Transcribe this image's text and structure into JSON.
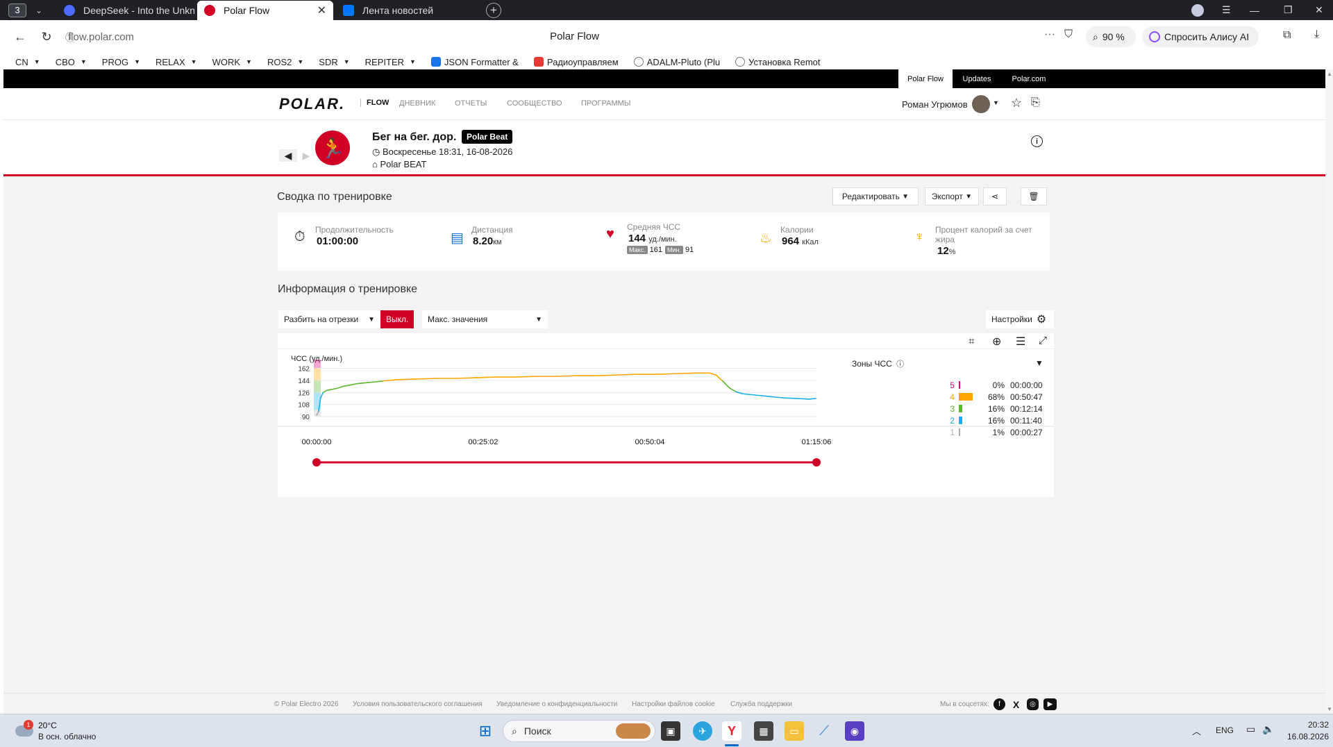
{
  "browser": {
    "tab_count": "3",
    "tabs": [
      {
        "title": "DeepSeek - Into the Unkno",
        "icon_color": "#4d6bfe"
      },
      {
        "title": "Polar Flow",
        "icon_color": "#d10027"
      },
      {
        "title": "Лента новостей",
        "icon_color": "#0077ff"
      }
    ],
    "url": "flow.polar.com",
    "page_title": "Polar Flow",
    "zoom": "90 %",
    "alice_label": "Спросить Алису AI",
    "bookmarks": [
      {
        "label": "CN",
        "folder": true
      },
      {
        "label": "CBO",
        "folder": true
      },
      {
        "label": "PROG",
        "folder": true
      },
      {
        "label": "RELAX",
        "folder": true
      },
      {
        "label": "WORK",
        "folder": true
      },
      {
        "label": "ROS2",
        "folder": true
      },
      {
        "label": "SDR",
        "folder": true
      },
      {
        "label": "REPITER",
        "folder": true
      },
      {
        "label": "JSON Formatter &",
        "folder": false
      },
      {
        "label": "Радиоуправляем",
        "folder": false
      },
      {
        "label": "ADALM-Pluto (Plu",
        "folder": false
      },
      {
        "label": "Установка Remot",
        "folder": false
      }
    ]
  },
  "site": {
    "top_links": [
      "Polar Flow",
      "Updates",
      "Polar.com"
    ],
    "logo": "POLAR.",
    "logo_sub": "FLOW",
    "nav": [
      "ДНЕВНИК",
      "ОТЧЕТЫ",
      "СООБЩЕСТВО",
      "ПРОГРАММЫ"
    ],
    "user_name": "Роман Угрюмов"
  },
  "activity": {
    "title": "Бег на бег. дор.",
    "badge": "Polar Beat",
    "date": "Воскресенье 18:31, 16-08-2026",
    "device": "Polar BEAT"
  },
  "summary": {
    "title": "Сводка по тренировке",
    "edit_label": "Редактировать",
    "export_label": "Экспорт",
    "duration": {
      "label": "Продолжительность",
      "value": "01:00:00"
    },
    "distance": {
      "label": "Дистанция",
      "value": "8.20",
      "unit": "км"
    },
    "hr": {
      "label": "Средняя ЧСС",
      "value": "144",
      "unit": "уд./мин.",
      "max_label": "Макс.",
      "max": "161",
      "min_label": "Мин.",
      "min": "91"
    },
    "calories": {
      "label": "Калории",
      "value": "964",
      "unit": "кКал"
    },
    "fat": {
      "label": "Процент калорий за счет жира",
      "value": "12",
      "unit": "%"
    }
  },
  "info": {
    "title": "Информация о тренировке",
    "split_label": "Разбить на отрезки",
    "off_label": "Выкл.",
    "max_values_label": "Макс. значения",
    "settings_label": "Настройки"
  },
  "chart_data": {
    "type": "line",
    "ylabel": "ЧСС (уд./мин.)",
    "y_ticks": [
      90,
      108,
      126,
      144,
      162
    ],
    "ylim": [
      90,
      175
    ],
    "x_tick_labels": [
      "00:00:00",
      "00:25:02",
      "00:50:04",
      "01:15:06"
    ],
    "xlim_min": [
      0,
      75.1
    ],
    "x": [
      0,
      0.3,
      0.6,
      1,
      1.5,
      2,
      3,
      4,
      5,
      6,
      8,
      10,
      12,
      15,
      18,
      21,
      24,
      27,
      30,
      33,
      36,
      39,
      42,
      45,
      48,
      51,
      54,
      57,
      59,
      60,
      61,
      62,
      63,
      64,
      66,
      68,
      70,
      72,
      74,
      75
    ],
    "y": [
      92,
      98,
      118,
      126,
      129,
      130,
      132,
      135,
      137,
      139,
      141,
      143,
      145,
      146,
      147,
      147,
      148,
      149,
      149,
      150,
      150,
      151,
      151,
      152,
      153,
      153,
      154,
      155,
      155,
      152,
      143,
      133,
      127,
      124,
      122,
      120,
      118,
      117,
      116,
      117
    ],
    "grid": true,
    "zones_title": "Зоны ЧСС",
    "zones": [
      {
        "zone": "5",
        "percent": "0%",
        "time": "00:00:00",
        "color": "#e6007e",
        "fraction": 0.0
      },
      {
        "zone": "4",
        "percent": "68%",
        "time": "00:50:47",
        "color": "#ffa600",
        "fraction": 0.68
      },
      {
        "zone": "3",
        "percent": "16%",
        "time": "00:12:14",
        "color": "#5cb82c",
        "fraction": 0.16
      },
      {
        "zone": "2",
        "percent": "16%",
        "time": "00:11:40",
        "color": "#1ab0e8",
        "fraction": 0.16
      },
      {
        "zone": "1",
        "percent": "1%",
        "time": "00:00:27",
        "color": "#aaaaaa",
        "fraction": 0.01
      }
    ]
  },
  "footer": {
    "copyright": "© Polar Electro 2026",
    "links": [
      "Условия пользовательского соглашения",
      "Уведомление о конфиденциальности",
      "Настройки файлов cookie",
      "Служба поддержки"
    ],
    "social_label": "Мы в соцсетях:"
  },
  "taskbar": {
    "weather_temp": "20°C",
    "weather_desc": "В осн. облачно",
    "weather_badge": "1",
    "search_label": "Поиск",
    "lang": "ENG",
    "time": "20:32",
    "date": "16.08.2026"
  }
}
